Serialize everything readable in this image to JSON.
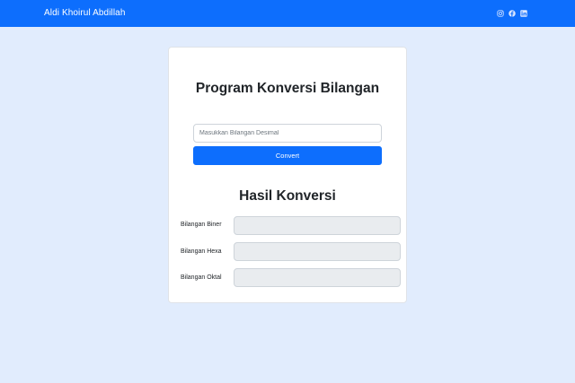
{
  "navbar": {
    "brand": "Aldi Khoirul Abdillah",
    "icons": [
      "instagram-icon",
      "facebook-icon",
      "linkedin-icon"
    ]
  },
  "converter": {
    "title": "Program Konversi Bilangan",
    "input_placeholder": "Masukkan Bilangan Desimal",
    "input_value": "",
    "button_label": "Convert"
  },
  "results": {
    "title": "Hasil Konversi",
    "rows": [
      {
        "label": "Bilangan Biner",
        "value": ""
      },
      {
        "label": "Bilangan Hexa",
        "value": ""
      },
      {
        "label": "Bilangan Oktal",
        "value": ""
      }
    ]
  },
  "colors": {
    "primary": "#0d6efd",
    "page_background": "#e1ecfd",
    "readonly_field": "#e9ecef"
  }
}
